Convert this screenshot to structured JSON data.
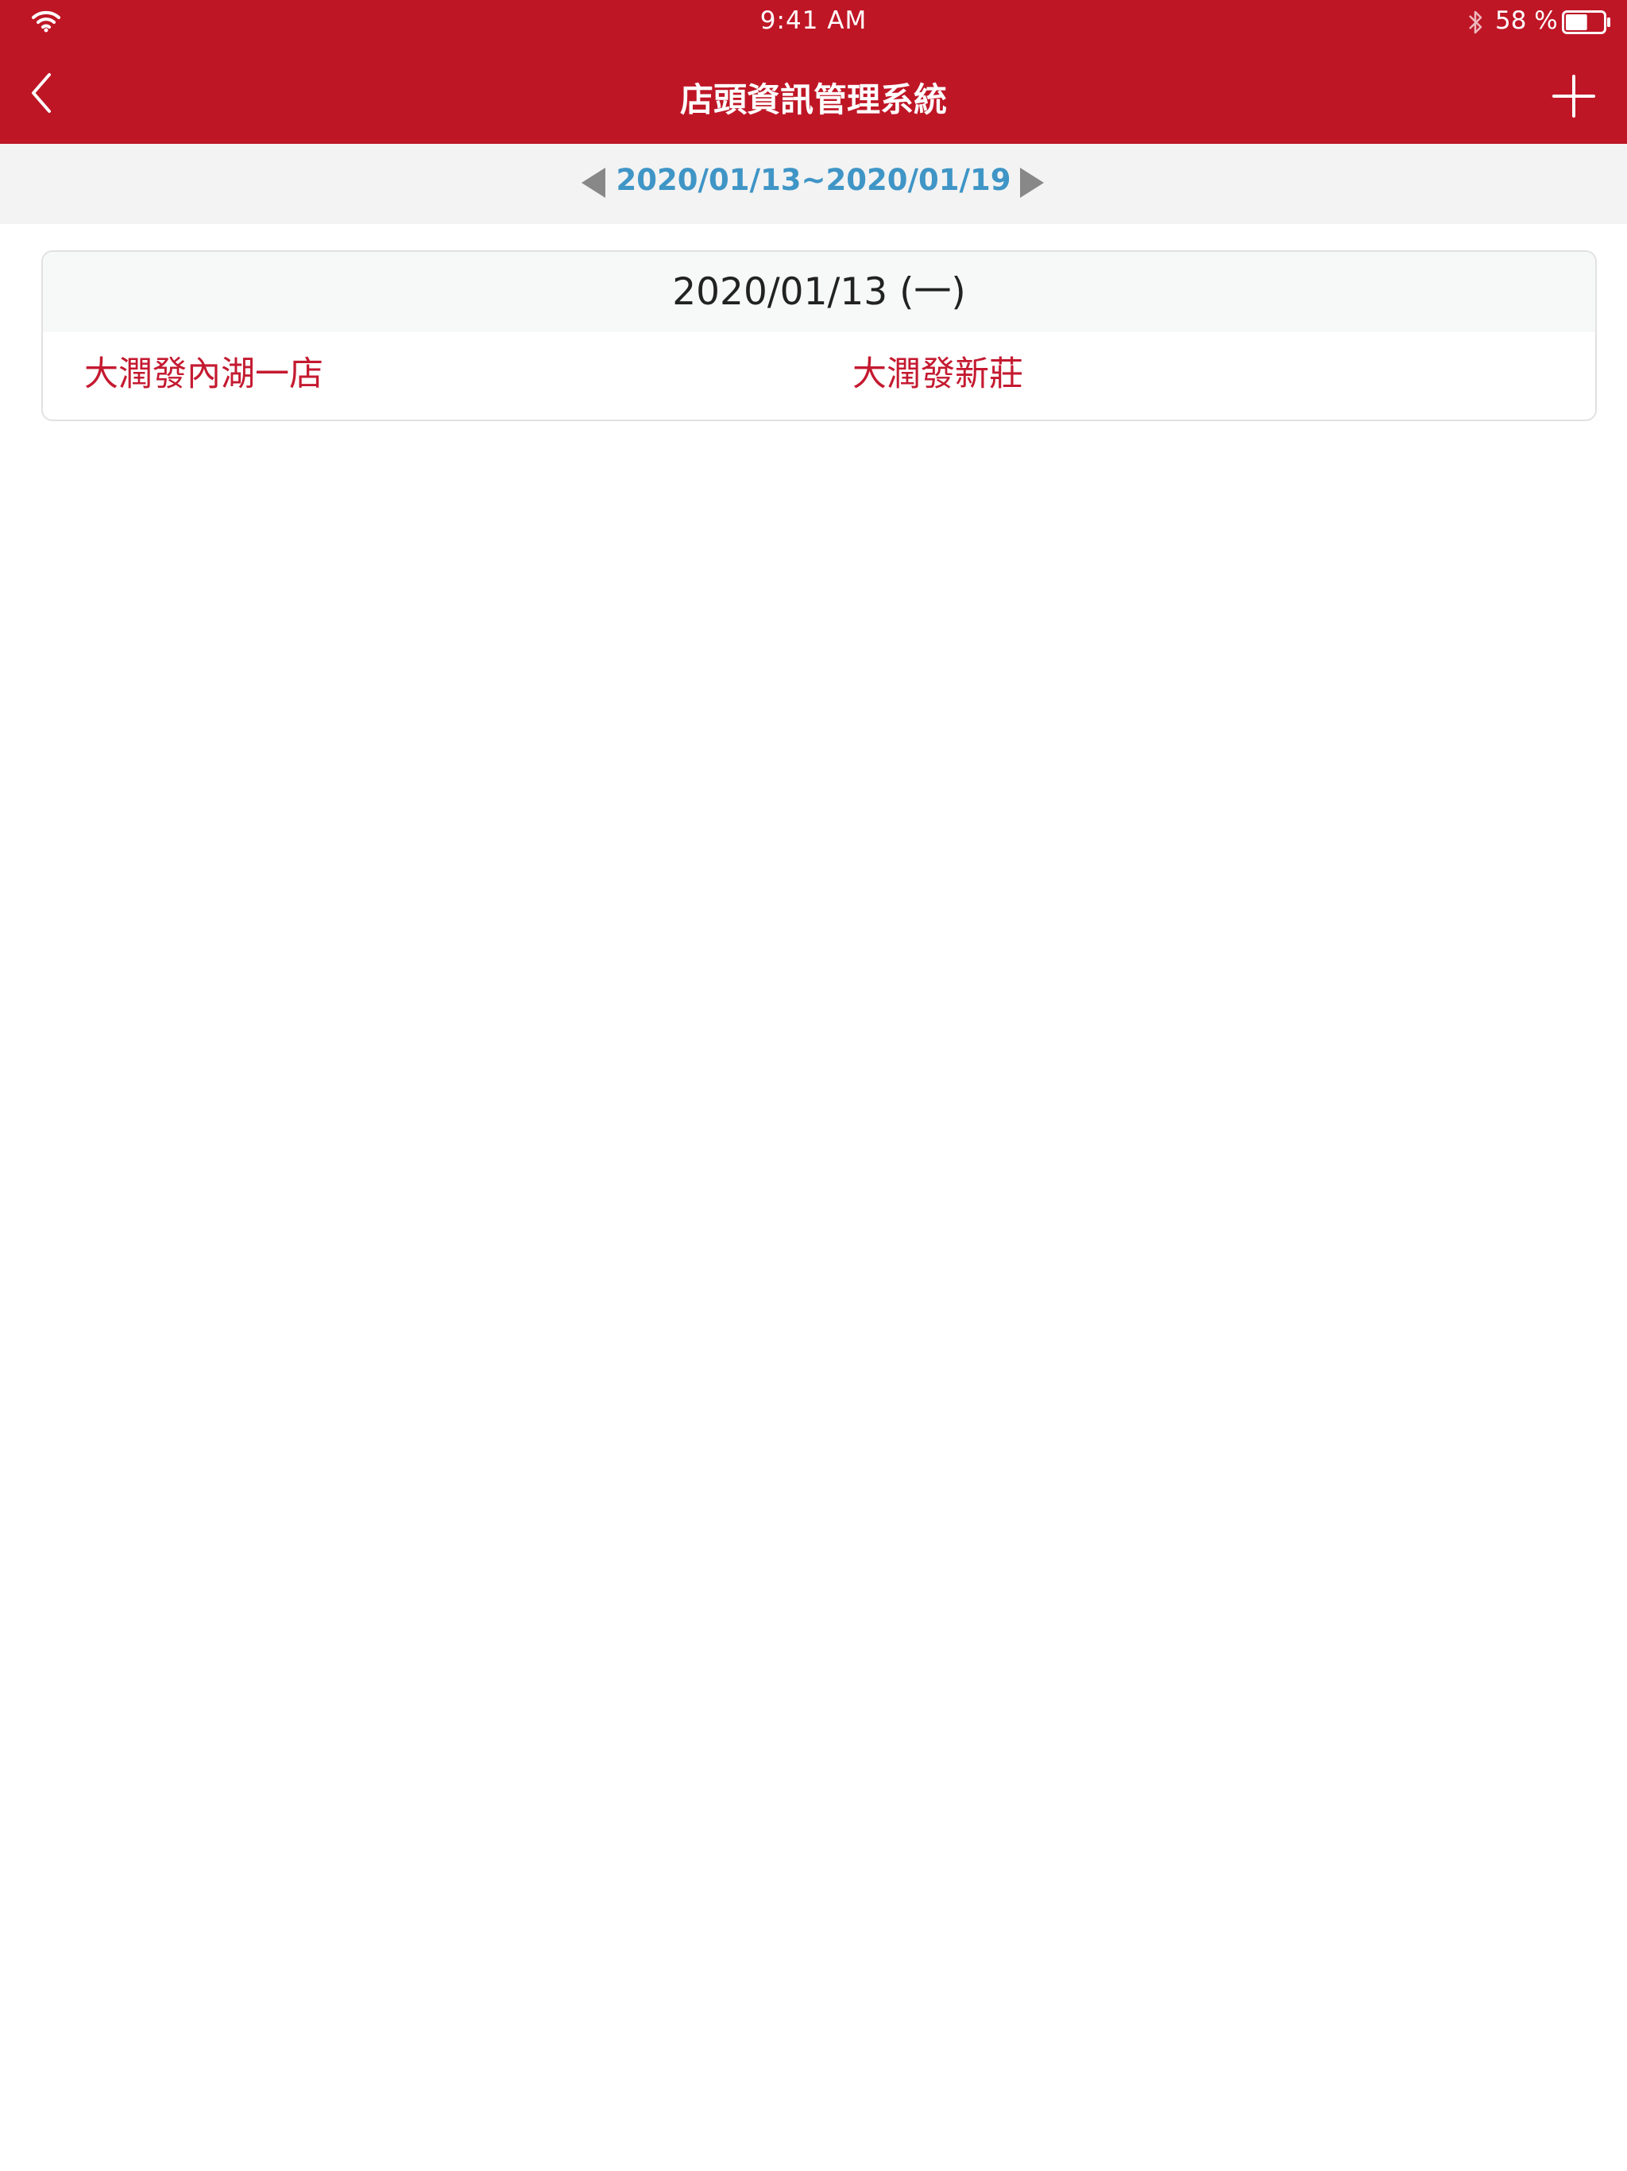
{
  "status_bar": {
    "time": "9:41 AM",
    "battery_percent": "58 %",
    "battery_level": 0.58,
    "icons": [
      "wifi-icon",
      "bluetooth-icon",
      "battery-icon"
    ]
  },
  "nav": {
    "title": "店頭資訊管理系統",
    "back_icon": "chevron-left-icon",
    "add_icon": "plus-icon"
  },
  "week": {
    "range": "2020/01/13~2020/01/19",
    "prev_icon": "triangle-left-icon",
    "next_icon": "triangle-right-icon"
  },
  "days": [
    {
      "date_label": "2020/01/13 (一)",
      "stores": [
        "大潤發內湖一店",
        "大潤發新莊"
      ]
    }
  ],
  "colors": {
    "brand_red": "#bf1626",
    "store_text": "#c41a30",
    "week_range": "#3f95c6",
    "week_bar_bg": "#f3f3f3"
  }
}
